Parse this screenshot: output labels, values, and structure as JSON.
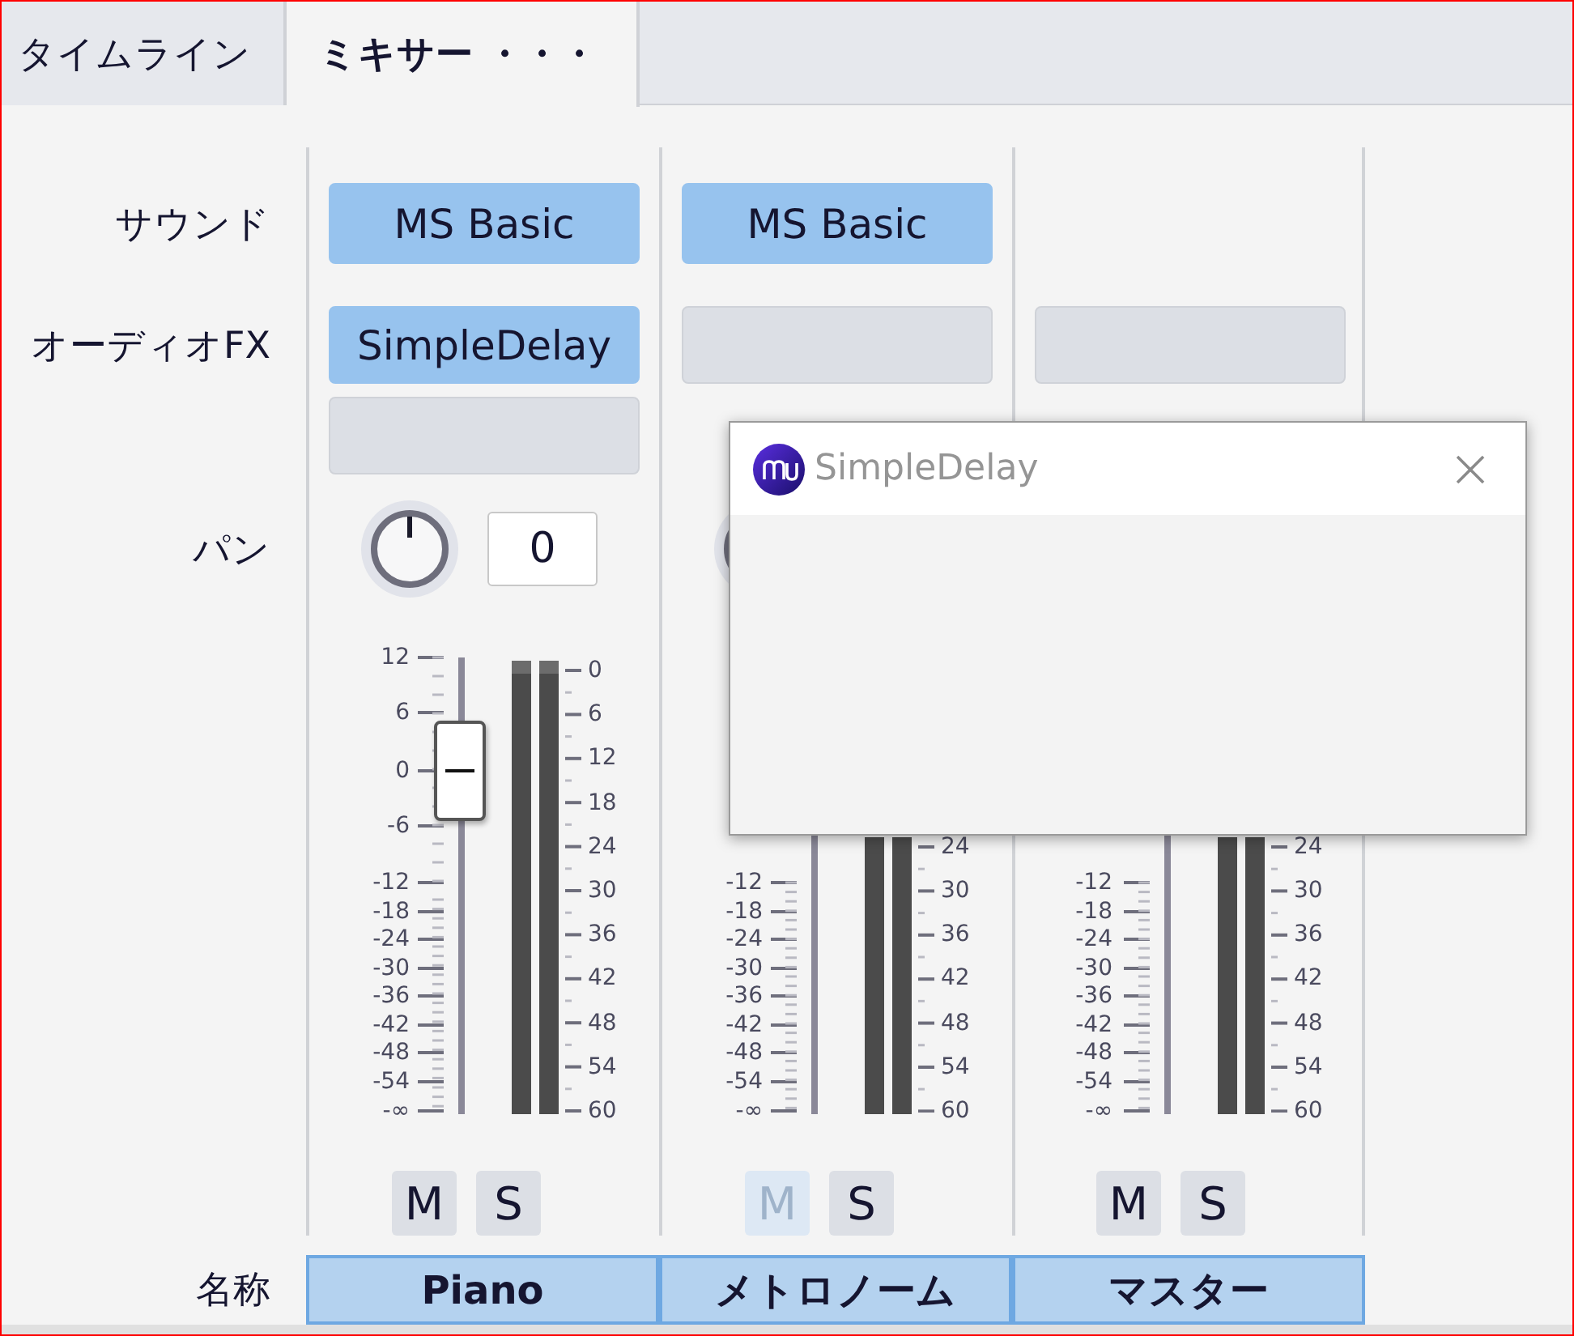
{
  "tabs": [
    {
      "label": "タイムライン",
      "selected": false
    },
    {
      "label": "ミキサー ・・・",
      "selected": true
    }
  ],
  "row_labels": {
    "sound": "サウンド",
    "fx": "オーディオFX",
    "pan": "パン",
    "name": "名称"
  },
  "channels": [
    {
      "name": "Piano",
      "sound": {
        "label": "MS Basic"
      },
      "fx": [
        {
          "kind": "plugin",
          "label": "SimpleDelay"
        },
        {
          "kind": "empty"
        }
      ],
      "pan": {
        "kind": "knob",
        "value": "0"
      },
      "fader": {
        "kind": "thumb"
      },
      "fader_labels": [
        "12",
        "6",
        "0",
        "-6",
        "-12",
        "-18",
        "-24",
        "-30",
        "-36",
        "-42",
        "-48",
        "-54",
        "-∞"
      ],
      "meter_labels": [
        "0",
        "6",
        "12",
        "18",
        "24",
        "30",
        "36",
        "42",
        "48",
        "54",
        "60"
      ],
      "mute": {
        "label": "M",
        "disabled": false
      },
      "solo": {
        "label": "S",
        "disabled": false
      }
    },
    {
      "name": "メトロノーム",
      "sound": {
        "label": "MS Basic"
      },
      "fx": [
        {
          "kind": "empty"
        }
      ],
      "pan": {
        "kind": "knob"
      },
      "fader_labels": [
        "-12",
        "-18",
        "-24",
        "-30",
        "-36",
        "-42",
        "-48",
        "-54",
        "-∞"
      ],
      "meter_labels": [
        "24",
        "30",
        "36",
        "42",
        "48",
        "54",
        "60"
      ],
      "mute": {
        "label": "M",
        "disabled": true
      },
      "solo": {
        "label": "S",
        "disabled": false
      }
    },
    {
      "name": "マスター",
      "fx": [
        {
          "kind": "empty"
        }
      ],
      "fader_labels": [
        "-12",
        "-18",
        "-24",
        "-30",
        "-36",
        "-42",
        "-48",
        "-54",
        "-∞"
      ],
      "meter_labels": [
        "24",
        "30",
        "36",
        "42",
        "48",
        "54",
        "60"
      ],
      "mute": {
        "label": "M",
        "disabled": false
      },
      "solo": {
        "label": "S",
        "disabled": false
      }
    }
  ],
  "plugin_window": {
    "title": "SimpleDelay"
  }
}
